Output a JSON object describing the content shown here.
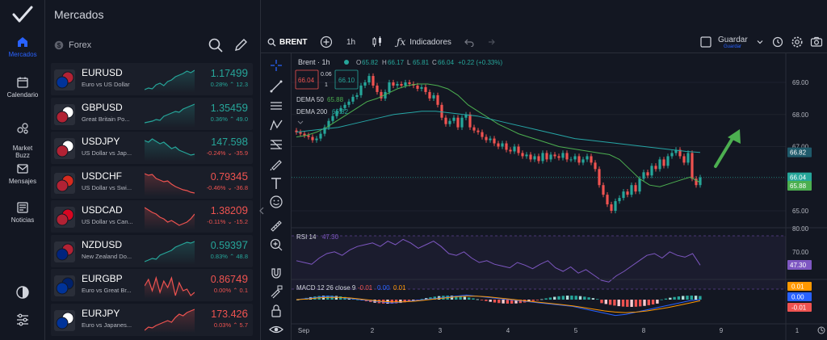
{
  "nav": {
    "items": [
      {
        "label": "Mercados",
        "active": true
      },
      {
        "label": "Calendario"
      },
      {
        "label": "Market\nBuzz"
      },
      {
        "label": "Mensajes"
      },
      {
        "label": "Noticias"
      }
    ]
  },
  "watchlist": {
    "title": "Mercados",
    "category": "Forex",
    "rows": [
      {
        "symbol": "EURUSD",
        "desc": "Euro vs US Dollar",
        "price_main": "1.174",
        "price_big": "99",
        "change": "0.28%",
        "change_pts": "12.3",
        "dir": "up"
      },
      {
        "symbol": "GBPUSD",
        "desc": "Great Britain Po...",
        "price_main": "1.354",
        "price_big": "59",
        "change": "0.36%",
        "change_pts": "49.0",
        "dir": "up"
      },
      {
        "symbol": "USDJPY",
        "desc": "US Dollar vs Jap...",
        "price_main": "147.59",
        "price_big": "8",
        "change": "-0.24%",
        "change_pts": "-35.9",
        "dir": "down_green"
      },
      {
        "symbol": "USDCHF",
        "desc": "US Dollar vs Swi...",
        "price_main": "0.793",
        "price_big": "45",
        "change": "-0.46%",
        "change_pts": "-36.8",
        "dir": "down"
      },
      {
        "symbol": "USDCAD",
        "desc": "US Dollar vs Can...",
        "price_main": "1.382",
        "price_big": "09",
        "change": "-0.11%",
        "change_pts": "-15.2",
        "dir": "down"
      },
      {
        "symbol": "NZDUSD",
        "desc": "New Zealand Do...",
        "price_main": "0.593",
        "price_big": "97",
        "change": "0.83%",
        "change_pts": "48.8",
        "dir": "up"
      },
      {
        "symbol": "EURGBP",
        "desc": "Euro vs Great Br...",
        "price_main": "0.867",
        "price_big": "49",
        "change": "0.00%",
        "change_pts": "0.1",
        "dir": "down"
      },
      {
        "symbol": "EURJPY",
        "desc": "Euro vs Japanes...",
        "price_main": "173.42",
        "price_big": "6",
        "change": "0.03%",
        "change_pts": "5.7",
        "dir": "down"
      }
    ]
  },
  "toolbar": {
    "symbol": "BRENT",
    "interval": "1h",
    "indicators_label": "Indicadores",
    "save_label": "Guardar",
    "save_sub": "Guardar"
  },
  "legend": {
    "title": "Brent · 1h",
    "o_label": "O",
    "o": "65.82",
    "h_label": "H",
    "h": "66.17",
    "l_label": "L",
    "l": "65.81",
    "c_label": "C",
    "c": "66.04",
    "chg": "+0.22 (+0.33%)",
    "sell": "66.04",
    "spread_top": "0.06",
    "spread_bot": "1",
    "buy": "66.10",
    "dema50_label": "DEMA 50",
    "dema50": "65.88",
    "dema200_label": "DEMA 200",
    "dema200": "66.82"
  },
  "rsi": {
    "label": "RSI 14",
    "value": "47.30",
    "levels": [
      "80.00",
      "70.00"
    ]
  },
  "macd": {
    "label": "MACD 12 26 close 9",
    "v1": "-0.01",
    "v2": "0.00",
    "v3": "0.01",
    "badges": [
      "0.01",
      "0.00",
      "-0.01"
    ]
  },
  "price_axis": [
    "69.00",
    "68.00",
    "67.00",
    "66.00",
    "65.00"
  ],
  "price_badges": {
    "dema200": "66.82",
    "last": "66.04",
    "dema50": "65.88"
  },
  "time_axis": [
    "Sep",
    "2",
    "3",
    "4",
    "5",
    "8",
    "9",
    "1"
  ],
  "colors": {
    "bg": "#131722",
    "up": "#26a69a",
    "down": "#ef5350",
    "accent": "#2962ff"
  }
}
